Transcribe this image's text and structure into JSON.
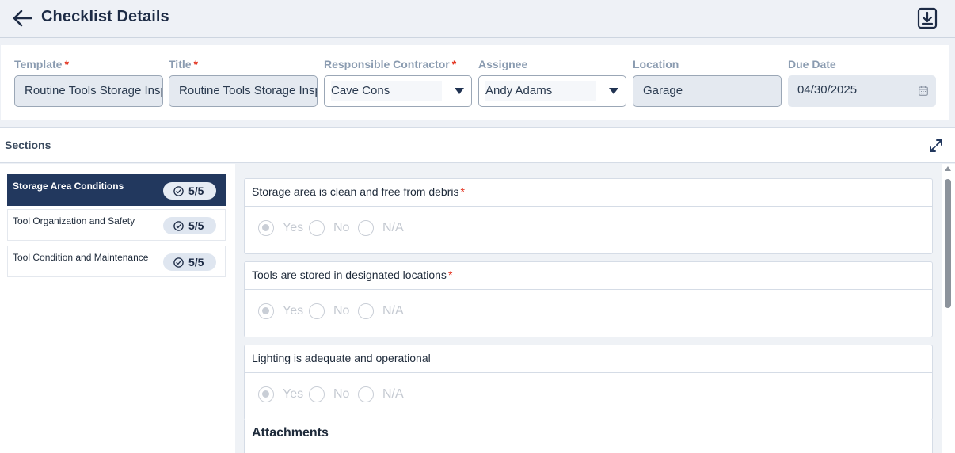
{
  "header": {
    "title": "Checklist Details",
    "back_icon": "arrow-left-icon",
    "download_icon": "download-icon"
  },
  "fields": {
    "template": {
      "label": "Template",
      "required": true,
      "value": "Routine Tools Storage Insp"
    },
    "title": {
      "label": "Title",
      "required": true,
      "value": "Routine Tools Storage Insp"
    },
    "contractor": {
      "label": "Responsible Contractor",
      "required": true,
      "value": "Cave Cons"
    },
    "assignee": {
      "label": "Assignee",
      "required": false,
      "value": "Andy Adams"
    },
    "location": {
      "label": "Location",
      "required": false,
      "value": "Garage"
    },
    "due_date": {
      "label": "Due Date",
      "required": false,
      "value": "04/30/2025"
    }
  },
  "sections": {
    "title": "Sections",
    "items": [
      {
        "label": "Storage Area Conditions",
        "count": "5/5",
        "active": true
      },
      {
        "label": "Tool Organization and Safety",
        "count": "5/5",
        "active": false
      },
      {
        "label": "Tool Condition and Maintenance",
        "count": "5/5",
        "active": false
      }
    ]
  },
  "questions": [
    {
      "text": "Storage area is clean and free from debris",
      "required": true,
      "options": [
        "Yes",
        "No",
        "N/A"
      ],
      "selected": "Yes"
    },
    {
      "text": "Tools are stored in designated locations",
      "required": true,
      "options": [
        "Yes",
        "No",
        "N/A"
      ],
      "selected": "Yes"
    },
    {
      "text": "Lighting is adequate and operational",
      "required": false,
      "options": [
        "Yes",
        "No",
        "N/A"
      ],
      "selected": "Yes"
    }
  ],
  "attachments": {
    "title": "Attachments"
  },
  "required_marker": "*",
  "colors": {
    "primary": "#22385e",
    "required": "#e3331f",
    "label": "#8a9bb0"
  }
}
